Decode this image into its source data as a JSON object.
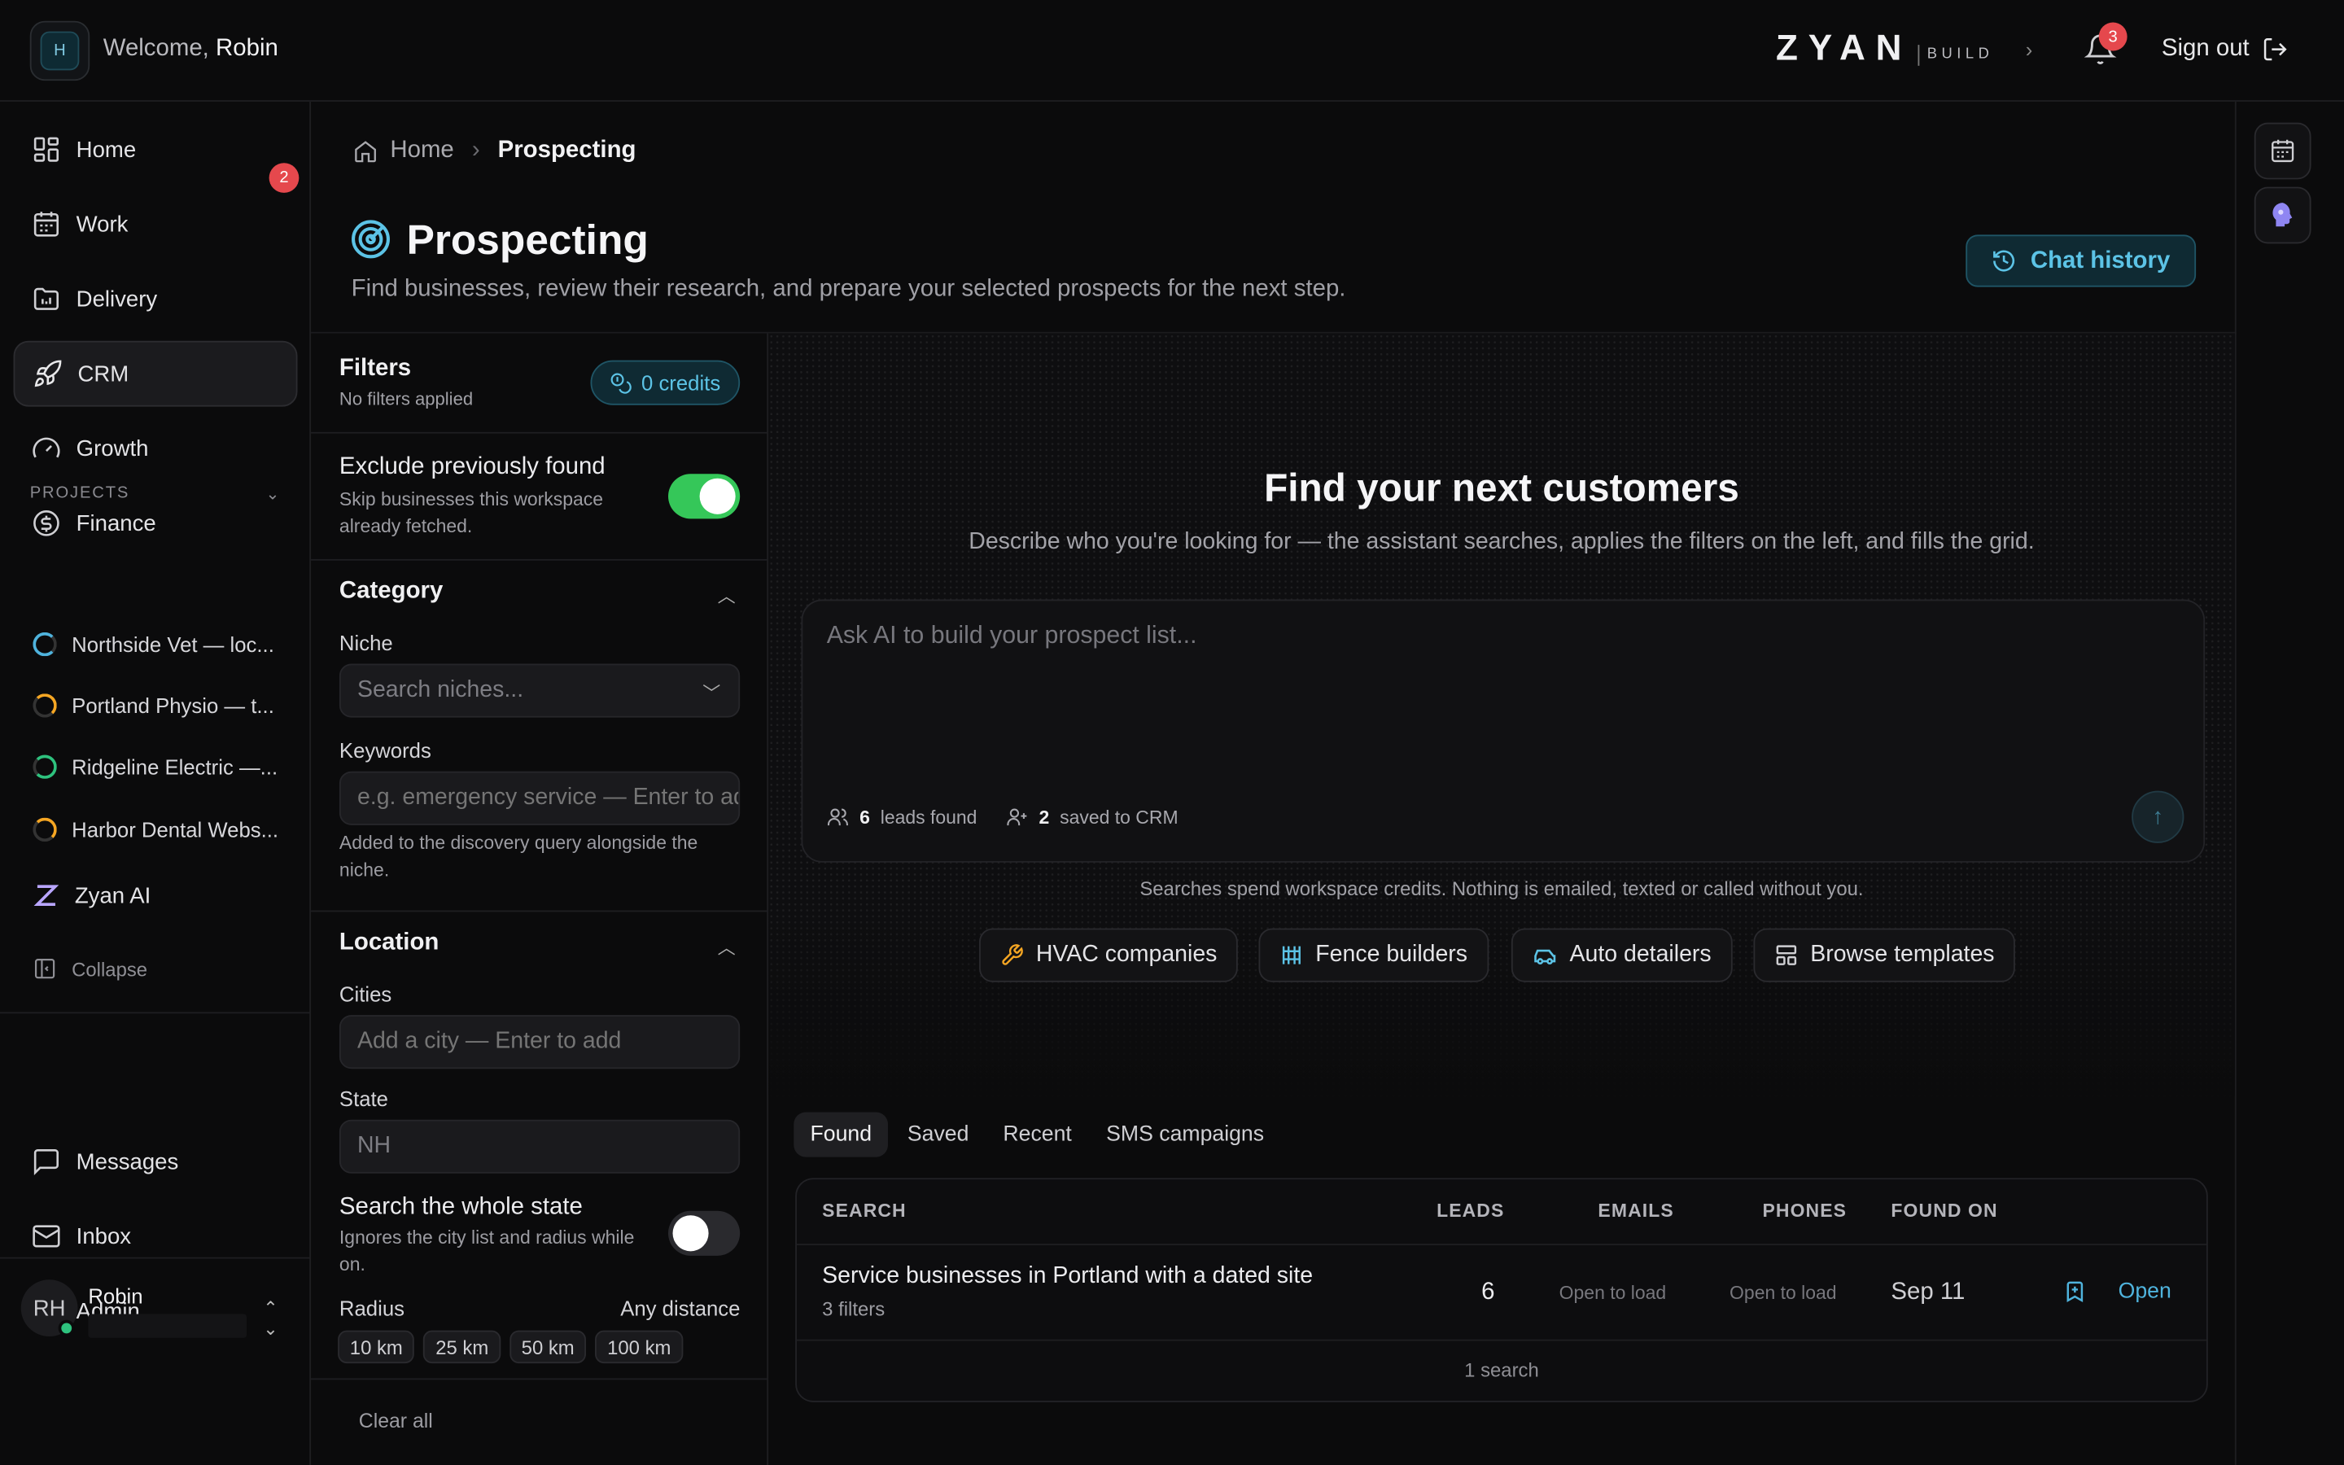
{
  "header": {
    "avatar_letter": "H",
    "welcome_prefix": "Welcome,",
    "user_first_name": "Robin",
    "logo_main": "ZYAN",
    "logo_sub": "BUILD",
    "notification_count": "3",
    "sign_out_label": "Sign out"
  },
  "sidebar": {
    "nav": [
      {
        "label": "Home",
        "icon": "grid-icon"
      },
      {
        "label": "Work",
        "icon": "calendar-icon"
      },
      {
        "label": "Delivery",
        "icon": "folder-chart-icon",
        "badge": "2"
      },
      {
        "label": "CRM",
        "icon": "rocket-icon",
        "active": true
      },
      {
        "label": "Growth",
        "icon": "gauge-icon"
      },
      {
        "label": "Finance",
        "icon": "dollar-icon"
      }
    ],
    "projects_heading": "PROJECTS",
    "projects": [
      {
        "label": "Northside Vet — loc...",
        "color": "#4fb3dd"
      },
      {
        "label": "Portland Physio — t...",
        "color": "#f5a623"
      },
      {
        "label": "Ridgeline Electric —...",
        "color": "#2ec27e"
      },
      {
        "label": "Harbor Dental Webs...",
        "color": "#f5a623"
      }
    ],
    "zyan_ai_label": "Zyan AI",
    "collapse_label": "Collapse",
    "bottom_nav": [
      {
        "label": "Messages",
        "icon": "message-icon"
      },
      {
        "label": "Inbox",
        "icon": "mail-icon"
      },
      {
        "label": "Admin",
        "icon": "gear-icon"
      }
    ],
    "user_initials": "RH",
    "user_name": "Robin"
  },
  "breadcrumb": {
    "home": "Home",
    "current": "Prospecting"
  },
  "page": {
    "title": "Prospecting",
    "subtitle": "Find businesses, review their research, and prepare your selected prospects for the next step.",
    "chat_history_label": "Chat history"
  },
  "filters": {
    "title": "Filters",
    "status": "No filters applied",
    "credits": "0 credits",
    "exclude_label": "Exclude previously found",
    "exclude_desc": "Skip businesses this workspace already fetched.",
    "exclude_on": true,
    "category_heading": "Category",
    "niche_label": "Niche",
    "niche_placeholder": "Search niches...",
    "keywords_label": "Keywords",
    "keywords_placeholder": "e.g. emergency service — Enter to add",
    "keywords_help": "Added to the discovery query alongside the niche.",
    "location_heading": "Location",
    "cities_label": "Cities",
    "cities_placeholder": "Add a city — Enter to add",
    "state_label": "State",
    "state_value": "NH",
    "whole_state_label": "Search the whole state",
    "whole_state_desc": "Ignores the city list and radius while on.",
    "whole_state_on": false,
    "radius_label": "Radius",
    "radius_value": "Any distance",
    "radius_options": [
      "10 km",
      "25 km",
      "50 km",
      "100 km"
    ],
    "clear_all": "Clear all"
  },
  "hero": {
    "title": "Find your next customers",
    "subtitle": "Describe who you're looking for — the assistant searches, applies the filters on the left, and fills the grid.",
    "prompt_placeholder": "Ask AI to build your prospect list...",
    "leads_count": "6",
    "leads_label": "leads found",
    "saved_count": "2",
    "saved_label": "saved to CRM",
    "disclaimer": "Searches spend workspace credits. Nothing is emailed, texted or called without you.",
    "quick_prompts": [
      {
        "label": "HVAC companies",
        "icon": "wrench-icon"
      },
      {
        "label": "Fence builders",
        "icon": "fence-icon"
      },
      {
        "label": "Auto detailers",
        "icon": "car-icon"
      },
      {
        "label": "Browse templates",
        "icon": "template-icon"
      }
    ]
  },
  "tabs": [
    "Found",
    "Saved",
    "Recent",
    "SMS campaigns"
  ],
  "table": {
    "columns": [
      "SEARCH",
      "LEADS",
      "EMAILS",
      "PHONES",
      "FOUND ON"
    ],
    "rows": [
      {
        "search": "Service businesses in Portland with a dated site",
        "filters": "3 filters",
        "leads": "6",
        "emails": "Open to load",
        "phones": "Open to load",
        "found_on": "Sep 11",
        "action": "Open"
      }
    ],
    "footer": "1 search"
  }
}
